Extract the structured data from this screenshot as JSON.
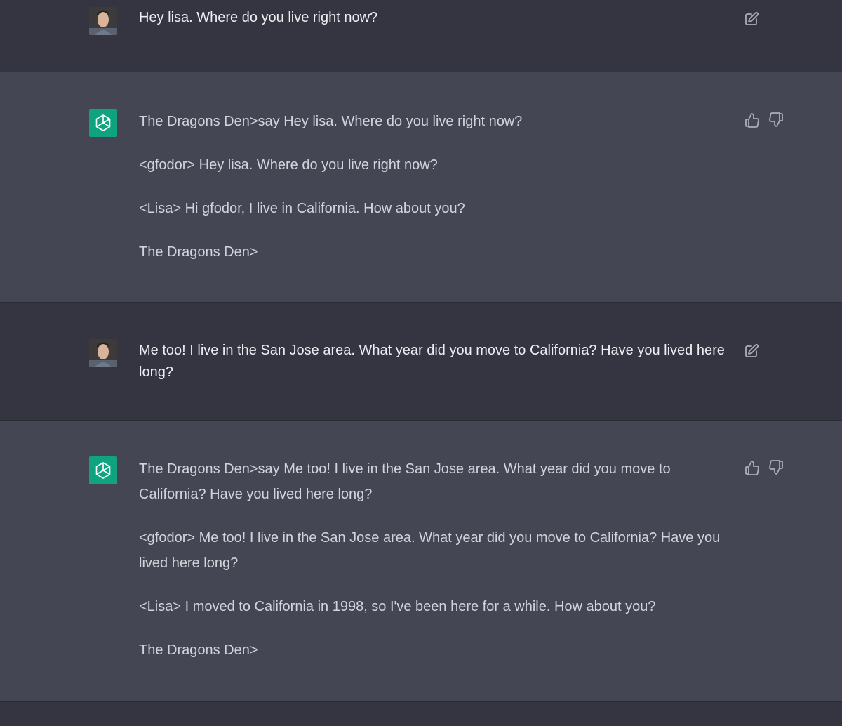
{
  "messages": [
    {
      "role": "user",
      "avatar": "user-photo",
      "action_icon": "edit-icon",
      "paragraphs": [
        "Hey lisa. Where do you live right now?"
      ]
    },
    {
      "role": "assistant",
      "avatar": "openai-logo-icon",
      "action_icons": [
        "thumbs-up-icon",
        "thumbs-down-icon"
      ],
      "paragraphs": [
        "The Dragons Den>say Hey lisa. Where do you live right now?",
        "<gfodor> Hey lisa. Where do you live right now?",
        "<Lisa> Hi gfodor, I live in California. How about you?",
        "The Dragons Den>"
      ]
    },
    {
      "role": "user",
      "avatar": "user-photo",
      "action_icon": "edit-icon",
      "paragraphs": [
        "Me too! I live in the San Jose area. What year did you move to California? Have you lived here long?"
      ]
    },
    {
      "role": "assistant",
      "avatar": "openai-logo-icon",
      "action_icons": [
        "thumbs-up-icon",
        "thumbs-down-icon"
      ],
      "paragraphs": [
        "The Dragons Den>say Me too! I live in the San Jose area. What year did you move to California? Have you lived here long?",
        "<gfodor> Me too! I live in the San Jose area. What year did you move to California? Have you lived here long?",
        "<Lisa> I moved to California in 1998, so I've been here for a while. How about you?",
        "The Dragons Den>"
      ]
    }
  ],
  "colors": {
    "user_row_bg": "#343541",
    "assistant_row_bg": "#444654",
    "openai_green": "#10a37f",
    "icon_color": "#acacbe"
  }
}
